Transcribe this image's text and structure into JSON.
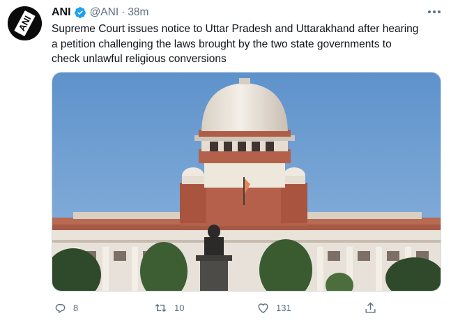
{
  "account": {
    "name": "ANI",
    "handle": "@ANI",
    "separator": "·",
    "time": "38m",
    "avatar_text": "ANI",
    "verified": true
  },
  "tweet": {
    "text_lines": [
      "Supreme Court issues notice to Uttar Pradesh and Uttarakhand after hearing",
      "a petition challenging the laws brought by the two state governments to",
      "check unlawful religious conversions"
    ]
  },
  "media": {
    "subject": "Supreme Court of India building"
  },
  "actions": {
    "reply_count": "8",
    "retweet_count": "10",
    "like_count": "131"
  },
  "icons": {
    "more": "more-icon",
    "verified": "verified-badge-icon",
    "reply": "reply-icon",
    "retweet": "retweet-icon",
    "like": "heart-icon",
    "share": "share-icon"
  },
  "colors": {
    "text": "#0f1419",
    "secondary": "#5b7083",
    "verified_blue": "#1da1f2",
    "sky": "#6f9fd1"
  }
}
